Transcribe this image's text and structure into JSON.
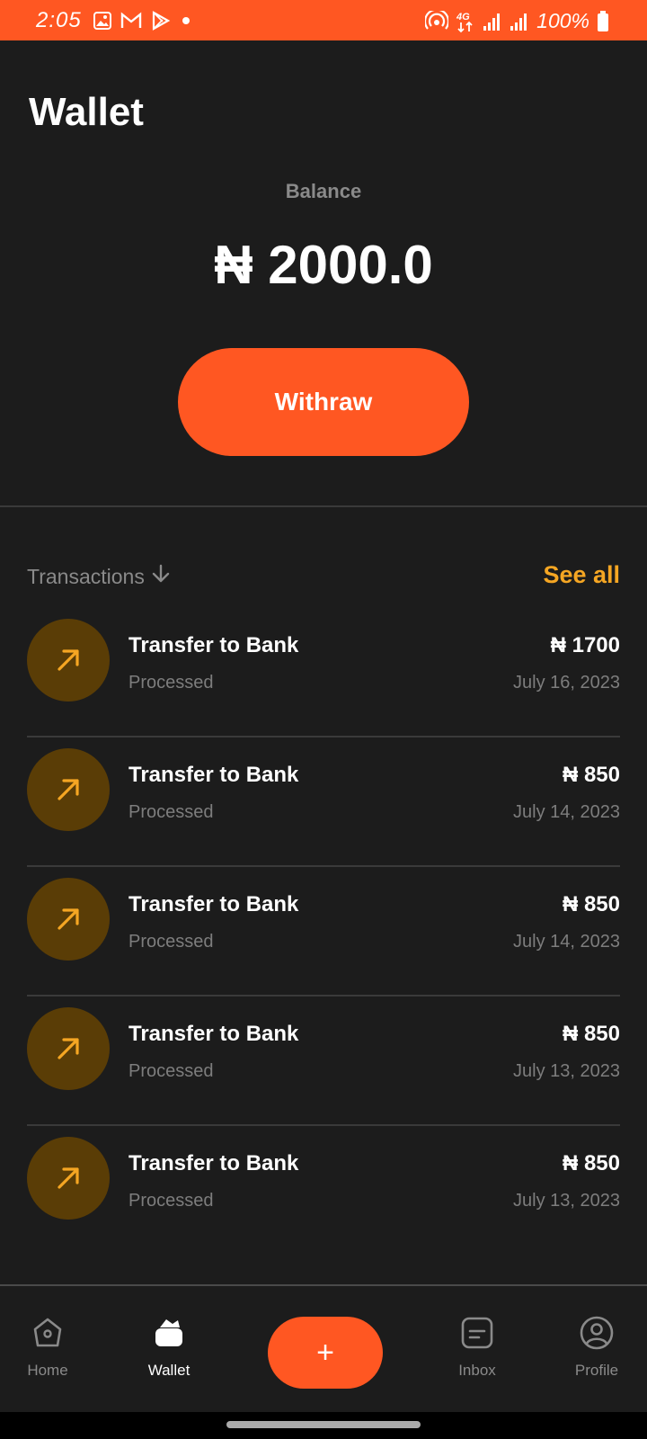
{
  "status_bar": {
    "time": "2:05",
    "battery": "100%",
    "network": "4G",
    "left_icons": [
      "image-icon",
      "gmail-icon",
      "play-store-icon",
      "dot-icon"
    ],
    "right_icons": [
      "hotspot-icon",
      "data-icon",
      "signal-icon",
      "signal-icon",
      "battery-icon"
    ]
  },
  "page": {
    "title": "Wallet"
  },
  "balance": {
    "label": "Balance",
    "value": "₦ 2000.0"
  },
  "actions": {
    "withdraw_label": "Withraw"
  },
  "transactions": {
    "header_label": "Transactions",
    "see_all_label": "See all",
    "items": [
      {
        "title": "Transfer to Bank",
        "status": "Processed",
        "amount": "₦ 1700",
        "date": "July 16, 2023"
      },
      {
        "title": "Transfer to Bank",
        "status": "Processed",
        "amount": "₦ 850",
        "date": "July 14, 2023"
      },
      {
        "title": "Transfer to Bank",
        "status": "Processed",
        "amount": "₦ 850",
        "date": "July 14, 2023"
      },
      {
        "title": "Transfer to Bank",
        "status": "Processed",
        "amount": "₦ 850",
        "date": "July 13, 2023"
      },
      {
        "title": "Transfer to Bank",
        "status": "Processed",
        "amount": "₦ 850",
        "date": "July 13, 2023"
      }
    ]
  },
  "bottom_nav": {
    "items": [
      {
        "label": "Home",
        "icon": "home-icon"
      },
      {
        "label": "Wallet",
        "icon": "wallet-icon",
        "active": true
      },
      {
        "label": "Inbox",
        "icon": "inbox-icon"
      },
      {
        "label": "Profile",
        "icon": "profile-icon"
      }
    ],
    "fab_label": "+"
  },
  "colors": {
    "accent": "#ff5722",
    "highlight": "#f5a623",
    "background": "#1c1c1c",
    "icon_bg": "#5a3d06"
  }
}
